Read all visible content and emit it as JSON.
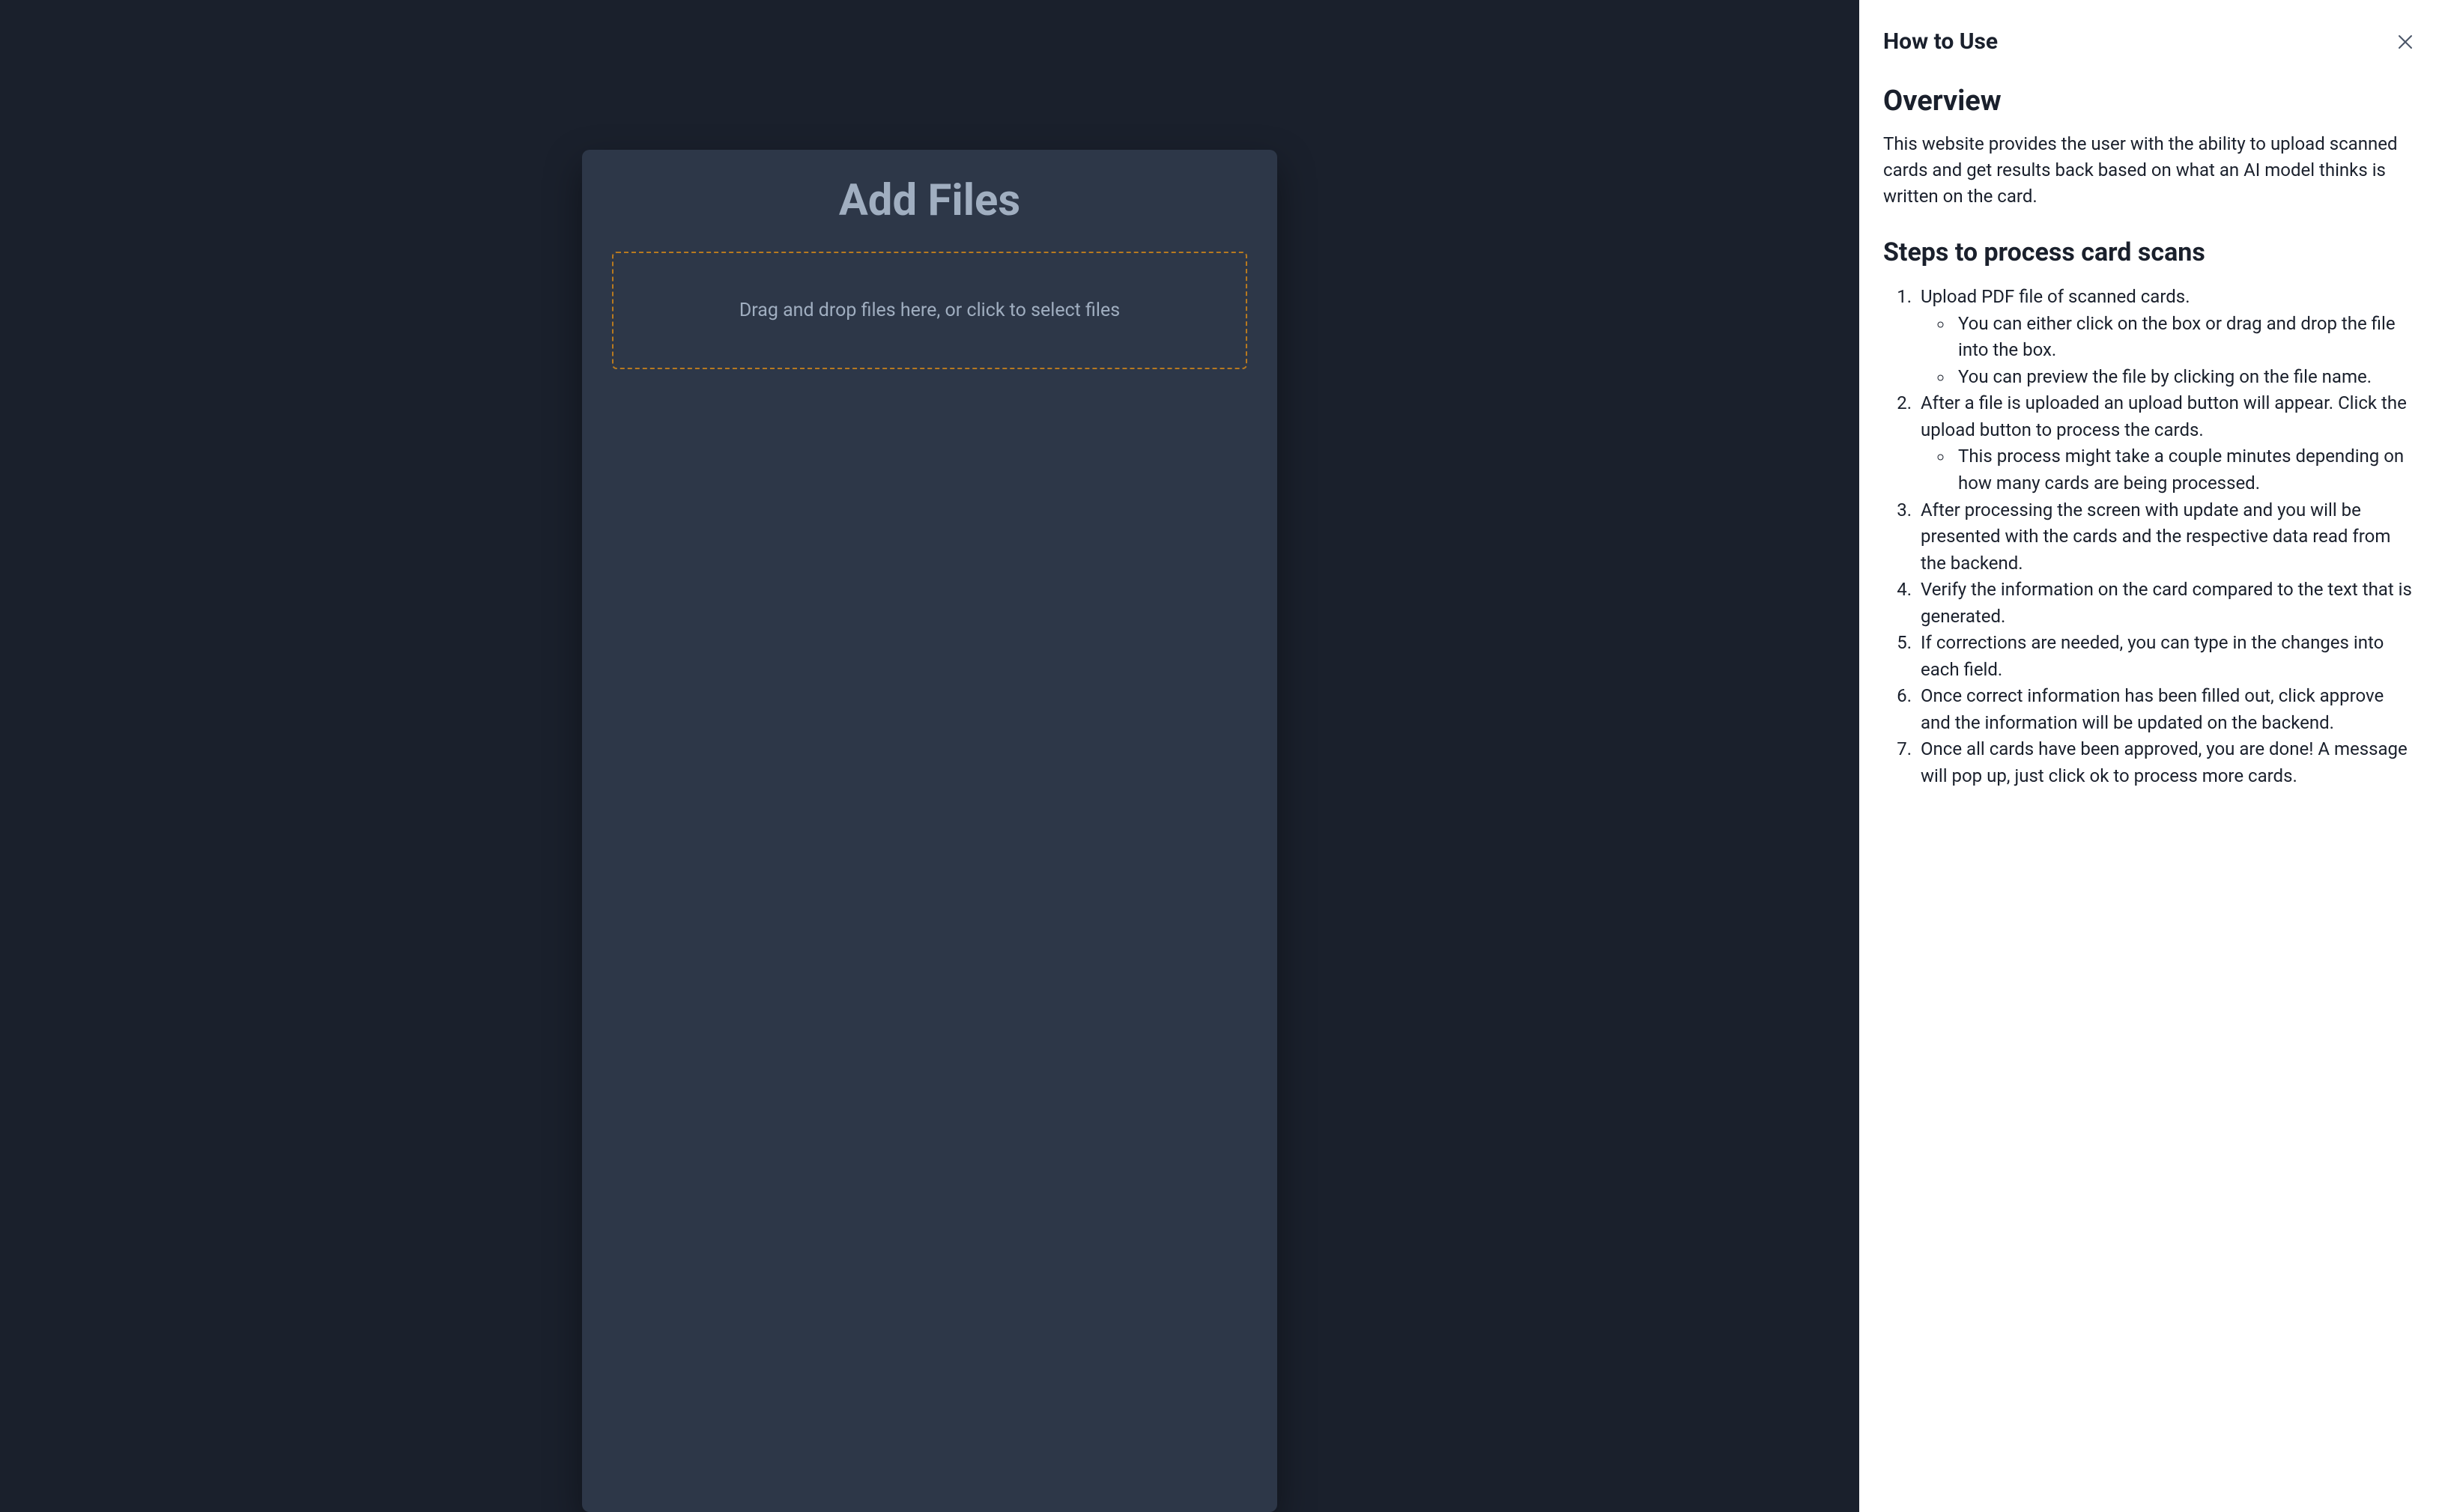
{
  "main": {
    "title": "Add Files",
    "dropzone_text": "Drag and drop files here, or click to select files"
  },
  "panel": {
    "title": "How to Use",
    "overview_heading": "Overview",
    "overview_text": "This website provides the user with the ability to upload scanned cards and get results back based on what an AI model thinks is written on the card.",
    "steps_heading": "Steps to process card scans",
    "steps": [
      {
        "text": "Upload PDF file of scanned cards.",
        "sub": [
          "You can either click on the box or drag and drop the file into the box.",
          "You can preview the file by clicking on the file name."
        ]
      },
      {
        "text": "After a file is uploaded an upload button will appear. Click the upload button to process the cards.",
        "sub": [
          "This process might take a couple minutes depending on how many cards are being processed."
        ]
      },
      {
        "text": "After processing the screen with update and you will be presented with the cards and the respective data read from the backend."
      },
      {
        "text": "Verify the information on the card compared to the text that is generated."
      },
      {
        "text": "If corrections are needed, you can type in the changes into each field."
      },
      {
        "text": "Once correct information has been filled out, click approve and the information will be updated on the backend."
      },
      {
        "text": "Once all cards have been approved, you are done! A message will pop up, just click ok to process more cards."
      }
    ]
  }
}
